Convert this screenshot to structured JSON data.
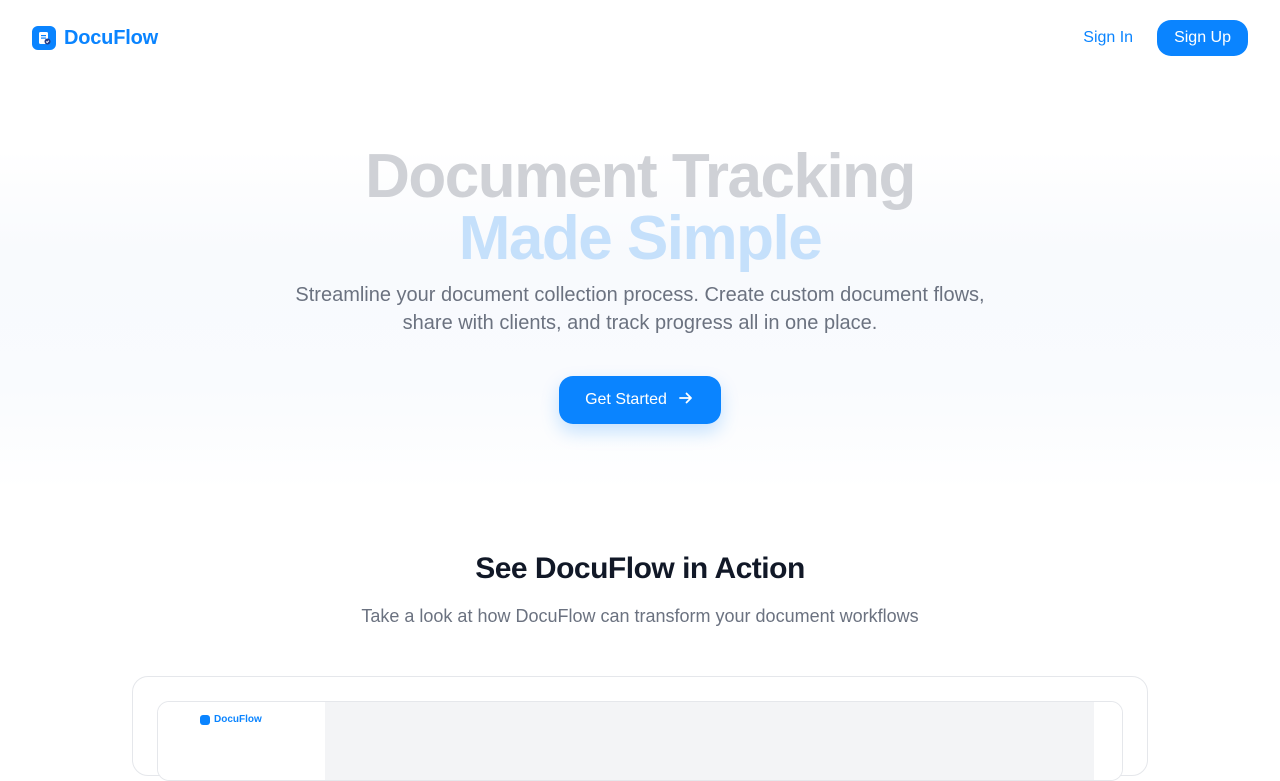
{
  "brand": {
    "name": "DocuFlow",
    "icon": "document-check-icon"
  },
  "nav": {
    "sign_in": "Sign In",
    "sign_up": "Sign Up"
  },
  "hero": {
    "title_line1": "Document Tracking",
    "title_line2": "Made Simple",
    "subtitle_line1": "Streamline your document collection process. Create custom document flows,",
    "subtitle_line2": "share with clients, and track progress all in one place.",
    "cta_label": "Get Started",
    "cta_icon": "arrow-right-icon"
  },
  "demo": {
    "title": "See DocuFlow in Action",
    "subtitle": "Take a look at how DocuFlow can transform your document workflows",
    "preview_brand": "DocuFlow"
  },
  "colors": {
    "accent": "#0a84ff",
    "heading": "#111827",
    "muted": "#6b7280"
  }
}
